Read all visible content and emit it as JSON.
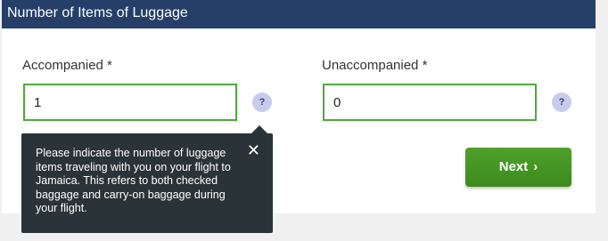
{
  "header": {
    "title": "Number of Items of Luggage"
  },
  "fields": {
    "accompanied": {
      "label": "Accompanied *",
      "value": "1"
    },
    "unaccompanied": {
      "label": "Unaccompanied *",
      "value": "0"
    }
  },
  "help": {
    "symbol": "?"
  },
  "tooltip": {
    "text": "Please indicate the number of luggage items traveling with you on your flight to Jamaica. This refers to both checked baggage and carry-on baggage during your flight.",
    "close_symbol": "✕"
  },
  "actions": {
    "next_label": "Next",
    "next_icon": "›"
  },
  "colors": {
    "header_bg": "#253f68",
    "input_border": "#4caa3c",
    "next_button": "#45952a",
    "tooltip_bg": "#2a3337",
    "help_bg": "#c7ccee"
  }
}
